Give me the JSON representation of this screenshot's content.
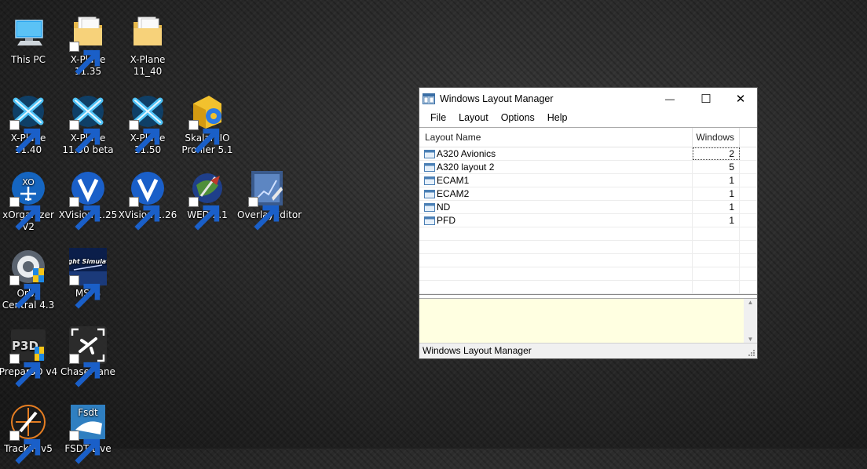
{
  "desktop": {
    "icons": [
      {
        "name": "this-pc",
        "label": "This PC"
      },
      {
        "name": "xplane-1135",
        "label": "X-Plane 11.35"
      },
      {
        "name": "xplane-11-40-folder",
        "label": "X-Plane 11_40"
      },
      {
        "name": "xplane-1140",
        "label": "X-Plane 11.40"
      },
      {
        "name": "xplane-1150-beta",
        "label": "X-Plane 11.50 beta"
      },
      {
        "name": "xplane-1150",
        "label": "X-Plane 11.50"
      },
      {
        "name": "skalarkio-profiler",
        "label": "SkalarkIO Profiler 5.1"
      },
      {
        "name": "xorganizer",
        "label": "xOrganizer V2"
      },
      {
        "name": "xvision-125",
        "label": "XVision 1.25"
      },
      {
        "name": "xvision-126",
        "label": "XVision 1.26"
      },
      {
        "name": "wed",
        "label": "WED 2.1"
      },
      {
        "name": "overlay-editor",
        "label": "OverlayEditor"
      },
      {
        "name": "orbx-central",
        "label": "Orbx Central 4.3"
      },
      {
        "name": "msfs",
        "label": "MSFS"
      },
      {
        "name": "prepar3d",
        "label": "Prepar3D v4"
      },
      {
        "name": "chaseplane",
        "label": "ChasePlane"
      },
      {
        "name": "trackir",
        "label": "TrackIR v5"
      },
      {
        "name": "fsdt-live",
        "label": "FSDT Live"
      }
    ],
    "msfs_logo_text": "Flight Simulator",
    "p3d_logo_text": "P3D",
    "fsdt_logo_text": "Fsdt",
    "xorg_logo_text": "XO"
  },
  "window": {
    "title": "Windows Layout Manager",
    "minimize": "—",
    "maximize": "☐",
    "close": "✕",
    "menu": [
      "File",
      "Layout",
      "Options",
      "Help"
    ],
    "columns": {
      "name": "Layout Name",
      "windows": "Windows"
    },
    "rows": [
      {
        "name": "A320 Avionics",
        "windows": "2"
      },
      {
        "name": "A320 layout 2",
        "windows": "5"
      },
      {
        "name": "ECAM1",
        "windows": "1"
      },
      {
        "name": "ECAM2",
        "windows": "1"
      },
      {
        "name": "ND",
        "windows": "1"
      },
      {
        "name": "PFD",
        "windows": "1"
      }
    ],
    "notes_scroll_up": "▲",
    "notes_scroll_down": "▼",
    "status": "Windows Layout Manager"
  },
  "colors": {
    "notes_bg": "#ffffe1",
    "xplane_blue": "#1e9be0",
    "xvision_blue": "#1a5fc8"
  }
}
